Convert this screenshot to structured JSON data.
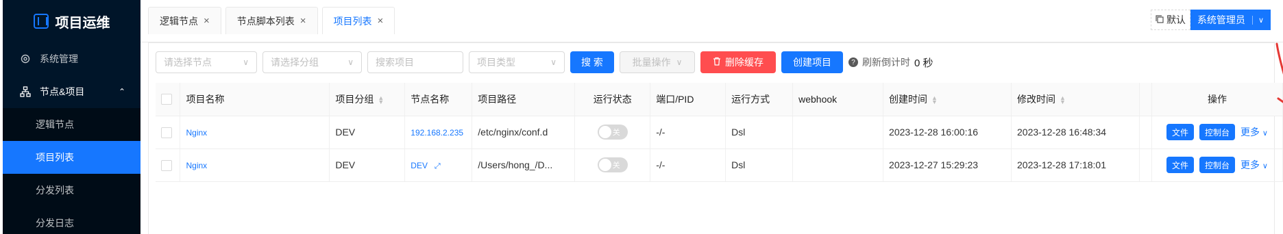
{
  "sidebar": {
    "brand": "项目运维",
    "menu": [
      {
        "label": "系统管理"
      },
      {
        "label": "节点&项目",
        "open": true
      }
    ],
    "submenu": [
      "逻辑节点",
      "项目列表",
      "分发列表",
      "分发日志"
    ],
    "active_index": 1
  },
  "tabs": [
    {
      "label": "逻辑节点",
      "close": "×"
    },
    {
      "label": "节点脚本列表",
      "close": "×"
    },
    {
      "label": "项目列表",
      "close": "×",
      "active": true
    }
  ],
  "header": {
    "default_label": "默认",
    "user_label": "系统管理员",
    "user_dropdown": "∨"
  },
  "toolbar": {
    "node_select_placeholder": "请选择节点",
    "group_select_placeholder": "请选择分组",
    "search_placeholder": "搜索项目",
    "type_select_placeholder": "项目类型",
    "search_button": "搜 索",
    "batch_button": "批量操作",
    "clear_cache_button": "删除缓存",
    "create_button": "创建项目",
    "countdown_label": "刷新倒计时",
    "countdown_value": "0 秒"
  },
  "table": {
    "headers": [
      "项目名称",
      "项目分组",
      "节点名称",
      "项目路径",
      "运行状态",
      "端口/PID",
      "运行方式",
      "webhook",
      "创建时间",
      "修改时间",
      "操作"
    ],
    "rows": [
      {
        "name": "Nginx",
        "group": "DEV",
        "node": "192.168.2.235",
        "path": "/etc/nginx/conf.d",
        "status": "关",
        "port": "-/-",
        "mode": "Dsl",
        "webhook": "",
        "created": "2023-12-28 16:00:16",
        "modified": "2023-12-28 16:48:34"
      },
      {
        "name": "Nginx",
        "group": "DEV",
        "node": "DEV",
        "path": "/Users/hong_/D...",
        "status": "关",
        "port": "-/-",
        "mode": "Dsl",
        "webhook": "",
        "created": "2023-12-27 15:29:23",
        "modified": "2023-12-28 17:18:01"
      }
    ],
    "actions": {
      "file": "文件",
      "console": "控制台",
      "more": "更多"
    }
  },
  "colors": {
    "primary": "#1677ff",
    "danger": "#ff4d4f",
    "sidebar": "#001529",
    "annotation": "#e53935"
  }
}
